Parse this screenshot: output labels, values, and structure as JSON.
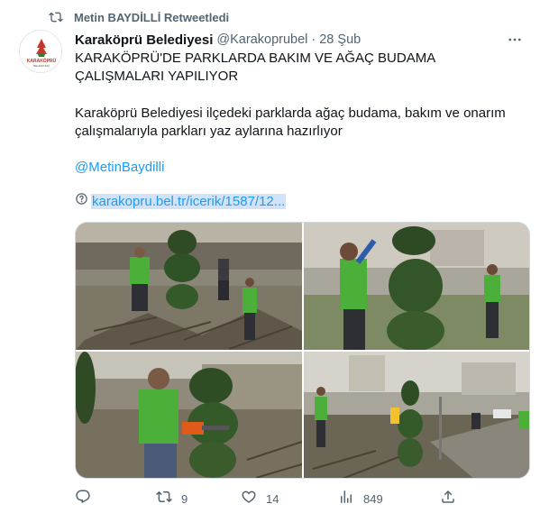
{
  "retweet": {
    "label": "Metin BAYDİLLİ Retweetledi",
    "icon": "retweet-icon"
  },
  "tweet": {
    "display_name": "Karaköprü Belediyesi",
    "handle": "@Karakoprubel",
    "separator": "·",
    "time": "28 Şub",
    "title": "KARAKÖPRÜ'DE PARKLARDA BAKIM VE AĞAÇ BUDAMA ÇALIŞMALARI YAPILIYOR",
    "description": "Karaköprü Belediyesi ilçedeki parklarda ağaç budama, bakım ve onarım çalışmalarıyla parkları yaz aylarına hazırlıyor",
    "mention": "@MetinBaydilli",
    "link": "karakopru.bel.tr/icerik/1587/12..."
  },
  "avatar": {
    "logo_text": "KARAKÖPRÜ",
    "logo_subtext": "BELEDİYESİ",
    "brand_color": "#c0392b"
  },
  "actions": {
    "reply_count": "",
    "retweet_count": "9",
    "like_count": "14",
    "view_count": "849",
    "share_count": ""
  },
  "colors": {
    "link": "#1d9bf0",
    "muted": "#536471",
    "text": "#0f1419",
    "vest": "#4caf3a"
  }
}
